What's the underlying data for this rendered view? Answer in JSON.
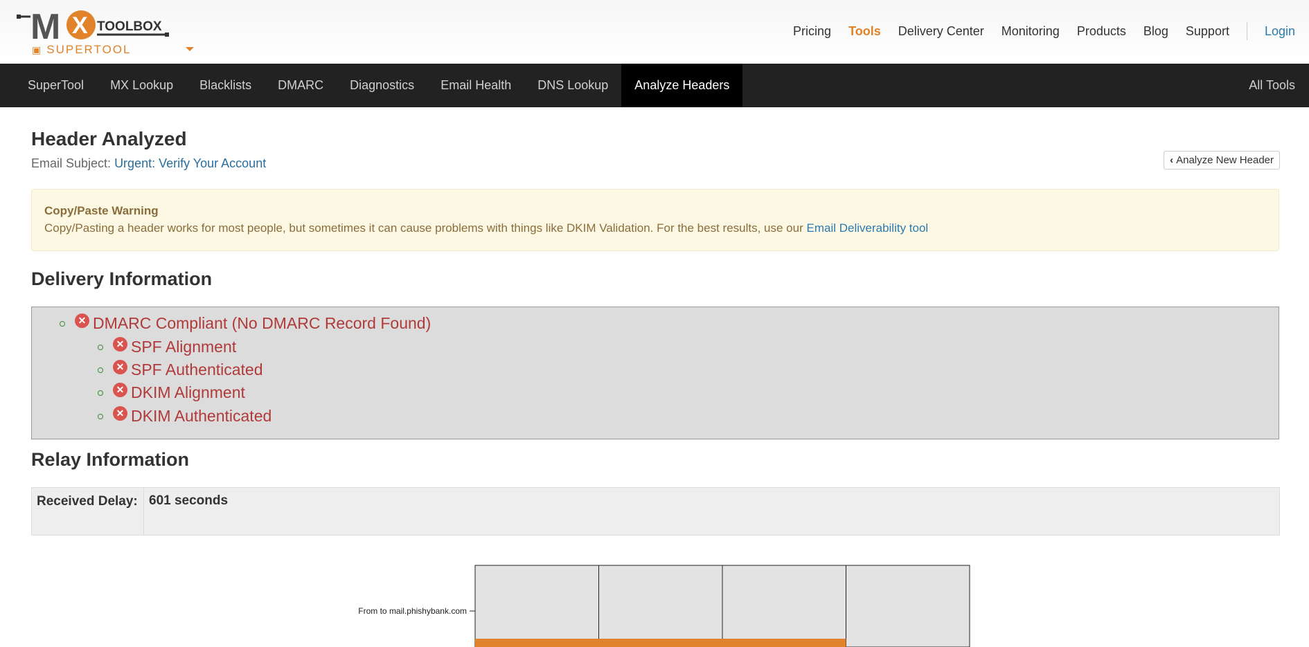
{
  "header": {
    "logo_text": "TOOLBOX",
    "logo_letters": "MX",
    "product": "SUPERTOOL",
    "nav": [
      "Pricing",
      "Tools",
      "Delivery Center",
      "Monitoring",
      "Products",
      "Blog",
      "Support"
    ],
    "active_nav": "Tools",
    "login": "Login"
  },
  "toolnav": {
    "items": [
      "SuperTool",
      "MX Lookup",
      "Blacklists",
      "DMARC",
      "Diagnostics",
      "Email Health",
      "DNS Lookup",
      "Analyze Headers"
    ],
    "active": "Analyze Headers",
    "all_tools": "All Tools"
  },
  "page": {
    "title": "Header Analyzed",
    "subject_label": "Email Subject: ",
    "subject_value": "Urgent: Verify Your Account",
    "new_header_button": "Analyze New Header"
  },
  "warning": {
    "title": "Copy/Paste Warning",
    "text": "Copy/Pasting a header works for most people, but sometimes it can cause problems with things like DKIM Validation. For the best results, use our ",
    "link": "Email Deliverability tool"
  },
  "delivery": {
    "heading": "Delivery Information",
    "main": "DMARC Compliant (No DMARC Record Found)",
    "checks": [
      "SPF Alignment",
      "SPF Authenticated",
      "DKIM Alignment",
      "DKIM Authenticated"
    ],
    "status_color": "#d9534f"
  },
  "relay": {
    "heading": "Relay Information",
    "delay_label": "Received Delay:",
    "delay_value": "601 seconds"
  },
  "chart_data": {
    "type": "bar",
    "categories": [
      "From  to mail.phishybank.com"
    ],
    "values": [
      0.75
    ],
    "bar_color": "#e0832b",
    "grid_color": "#e3e3e3"
  }
}
